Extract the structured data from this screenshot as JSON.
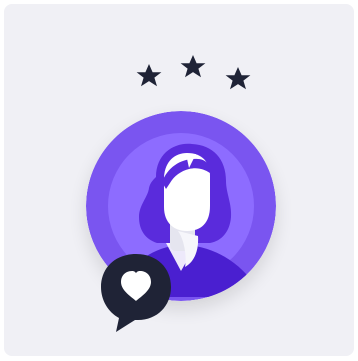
{
  "colors": {
    "card_background": "#f0f0f5",
    "star_color": "#1f2336",
    "avatar_circle_outer": "#7a55f0",
    "avatar_circle_inner": "#8d6cff",
    "hair_color": "#5a2bdc",
    "skin_color": "#ffffff",
    "shadow_color": "#dcdde8",
    "bubble_color": "#1f2336",
    "heart_color": "#ffffff"
  },
  "icons": {
    "stars": [
      "star-icon",
      "star-icon",
      "star-icon"
    ],
    "avatar": "person-avatar-icon",
    "bubble": "speech-bubble-icon",
    "heart": "heart-icon"
  },
  "rating": {
    "value": 3,
    "max": 3
  }
}
